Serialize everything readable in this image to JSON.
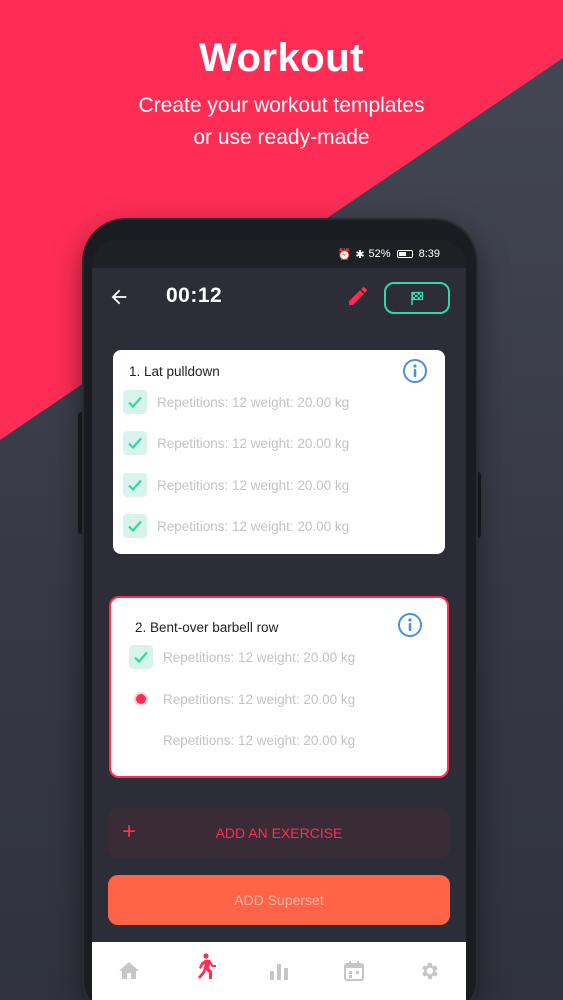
{
  "promo": {
    "title": "Workout",
    "subtitle_line1": "Create your workout templates",
    "subtitle_line2": "or use ready-made"
  },
  "status": {
    "battery": "52%",
    "time": "8:39"
  },
  "appbar": {
    "timer": "00:12"
  },
  "exercises": [
    {
      "title": "1. Lat pulldown",
      "sets": [
        {
          "text": "Repetitions: 12 weight: 20.00 kg",
          "state": "done"
        },
        {
          "text": "Repetitions: 12 weight: 20.00 kg",
          "state": "done"
        },
        {
          "text": "Repetitions: 12 weight: 20.00 kg",
          "state": "done"
        },
        {
          "text": "Repetitions: 12 weight: 20.00 kg",
          "state": "done"
        }
      ]
    },
    {
      "title": "2. Bent-over barbell row",
      "sets": [
        {
          "text": "Repetitions: 12 weight: 20.00 kg",
          "state": "done"
        },
        {
          "text": "Repetitions: 12 weight: 20.00 kg",
          "state": "current"
        },
        {
          "text": "Repetitions: 12 weight: 20.00 kg",
          "state": "pending"
        }
      ]
    }
  ],
  "buttons": {
    "add_exercise": "ADD AN EXERCISE",
    "add_superset": "ADD Superset"
  },
  "colors": {
    "accent": "#ff2d55",
    "check": "#33d6a6",
    "info": "#4a8fe0",
    "superset": "#ff6448"
  },
  "nav": [
    "home-icon",
    "workout-icon",
    "stats-icon",
    "calendar-icon",
    "settings-icon"
  ]
}
